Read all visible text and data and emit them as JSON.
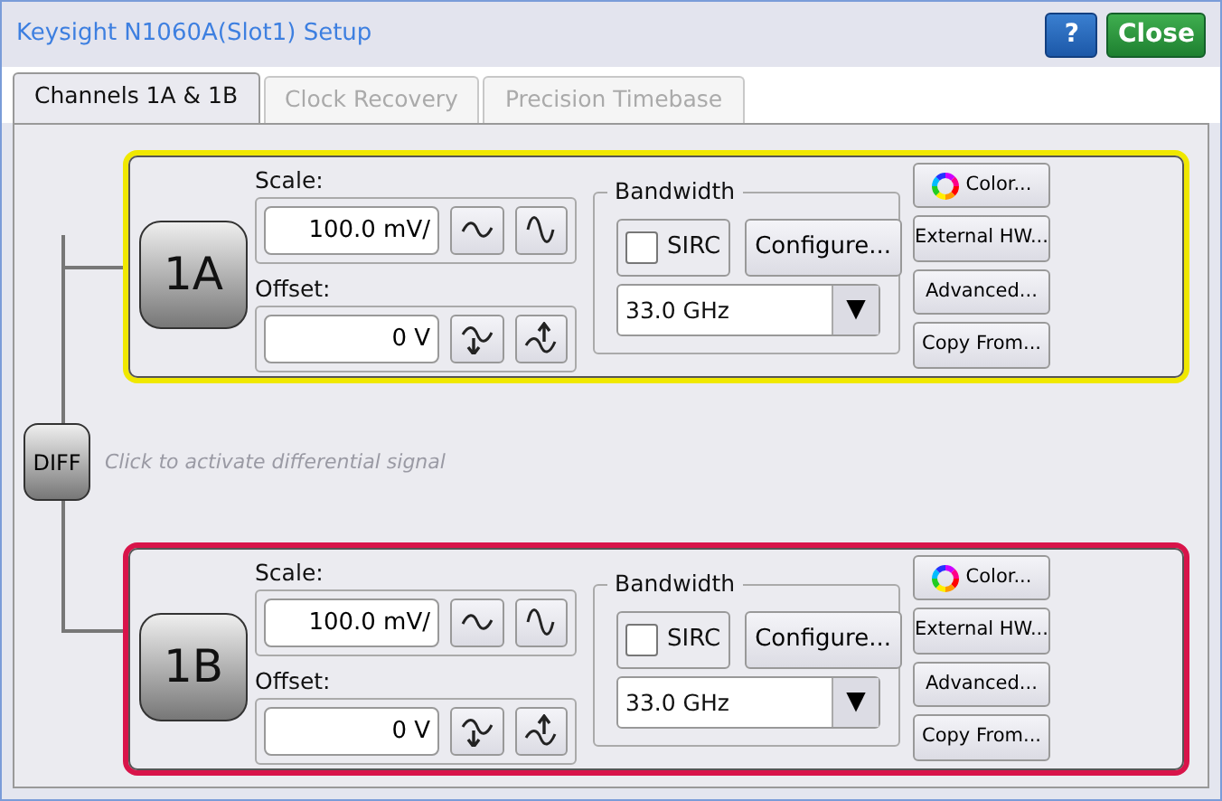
{
  "window": {
    "title": "Keysight N1060A(Slot1) Setup",
    "help_button": "?",
    "close_button": "Close"
  },
  "tabs": [
    {
      "label": "Channels 1A & 1B",
      "selected": true
    },
    {
      "label": "Clock Recovery",
      "selected": false
    },
    {
      "label": "Precision Timebase",
      "selected": false
    }
  ],
  "channels": [
    {
      "name": "1A",
      "color": "#f0e800",
      "scale_label": "Scale:",
      "scale": "100.0 mV/",
      "offset_label": "Offset:",
      "offset": "0 V",
      "bandwidth_label": "Bandwidth",
      "sirc_label": "SIRC",
      "sirc_checked": false,
      "configure": "Configure...",
      "bandwidth": "33.0 GHz",
      "dropdown_arrow": "▼",
      "buttons": [
        "Color...",
        "External HW...",
        "Advanced...",
        "Copy From..."
      ]
    },
    {
      "name": "1B",
      "color": "#d8144a",
      "scale_label": "Scale:",
      "scale": "100.0 mV/",
      "offset_label": "Offset:",
      "offset": "0 V",
      "bandwidth_label": "Bandwidth",
      "sirc_label": "SIRC",
      "sirc_checked": false,
      "configure": "Configure...",
      "bandwidth": "33.0 GHz",
      "dropdown_arrow": "▼",
      "buttons": [
        "Color...",
        "External HW...",
        "Advanced...",
        "Copy From..."
      ]
    }
  ],
  "diff": {
    "label": "DIFF",
    "hint": "Click to activate differential signal"
  }
}
